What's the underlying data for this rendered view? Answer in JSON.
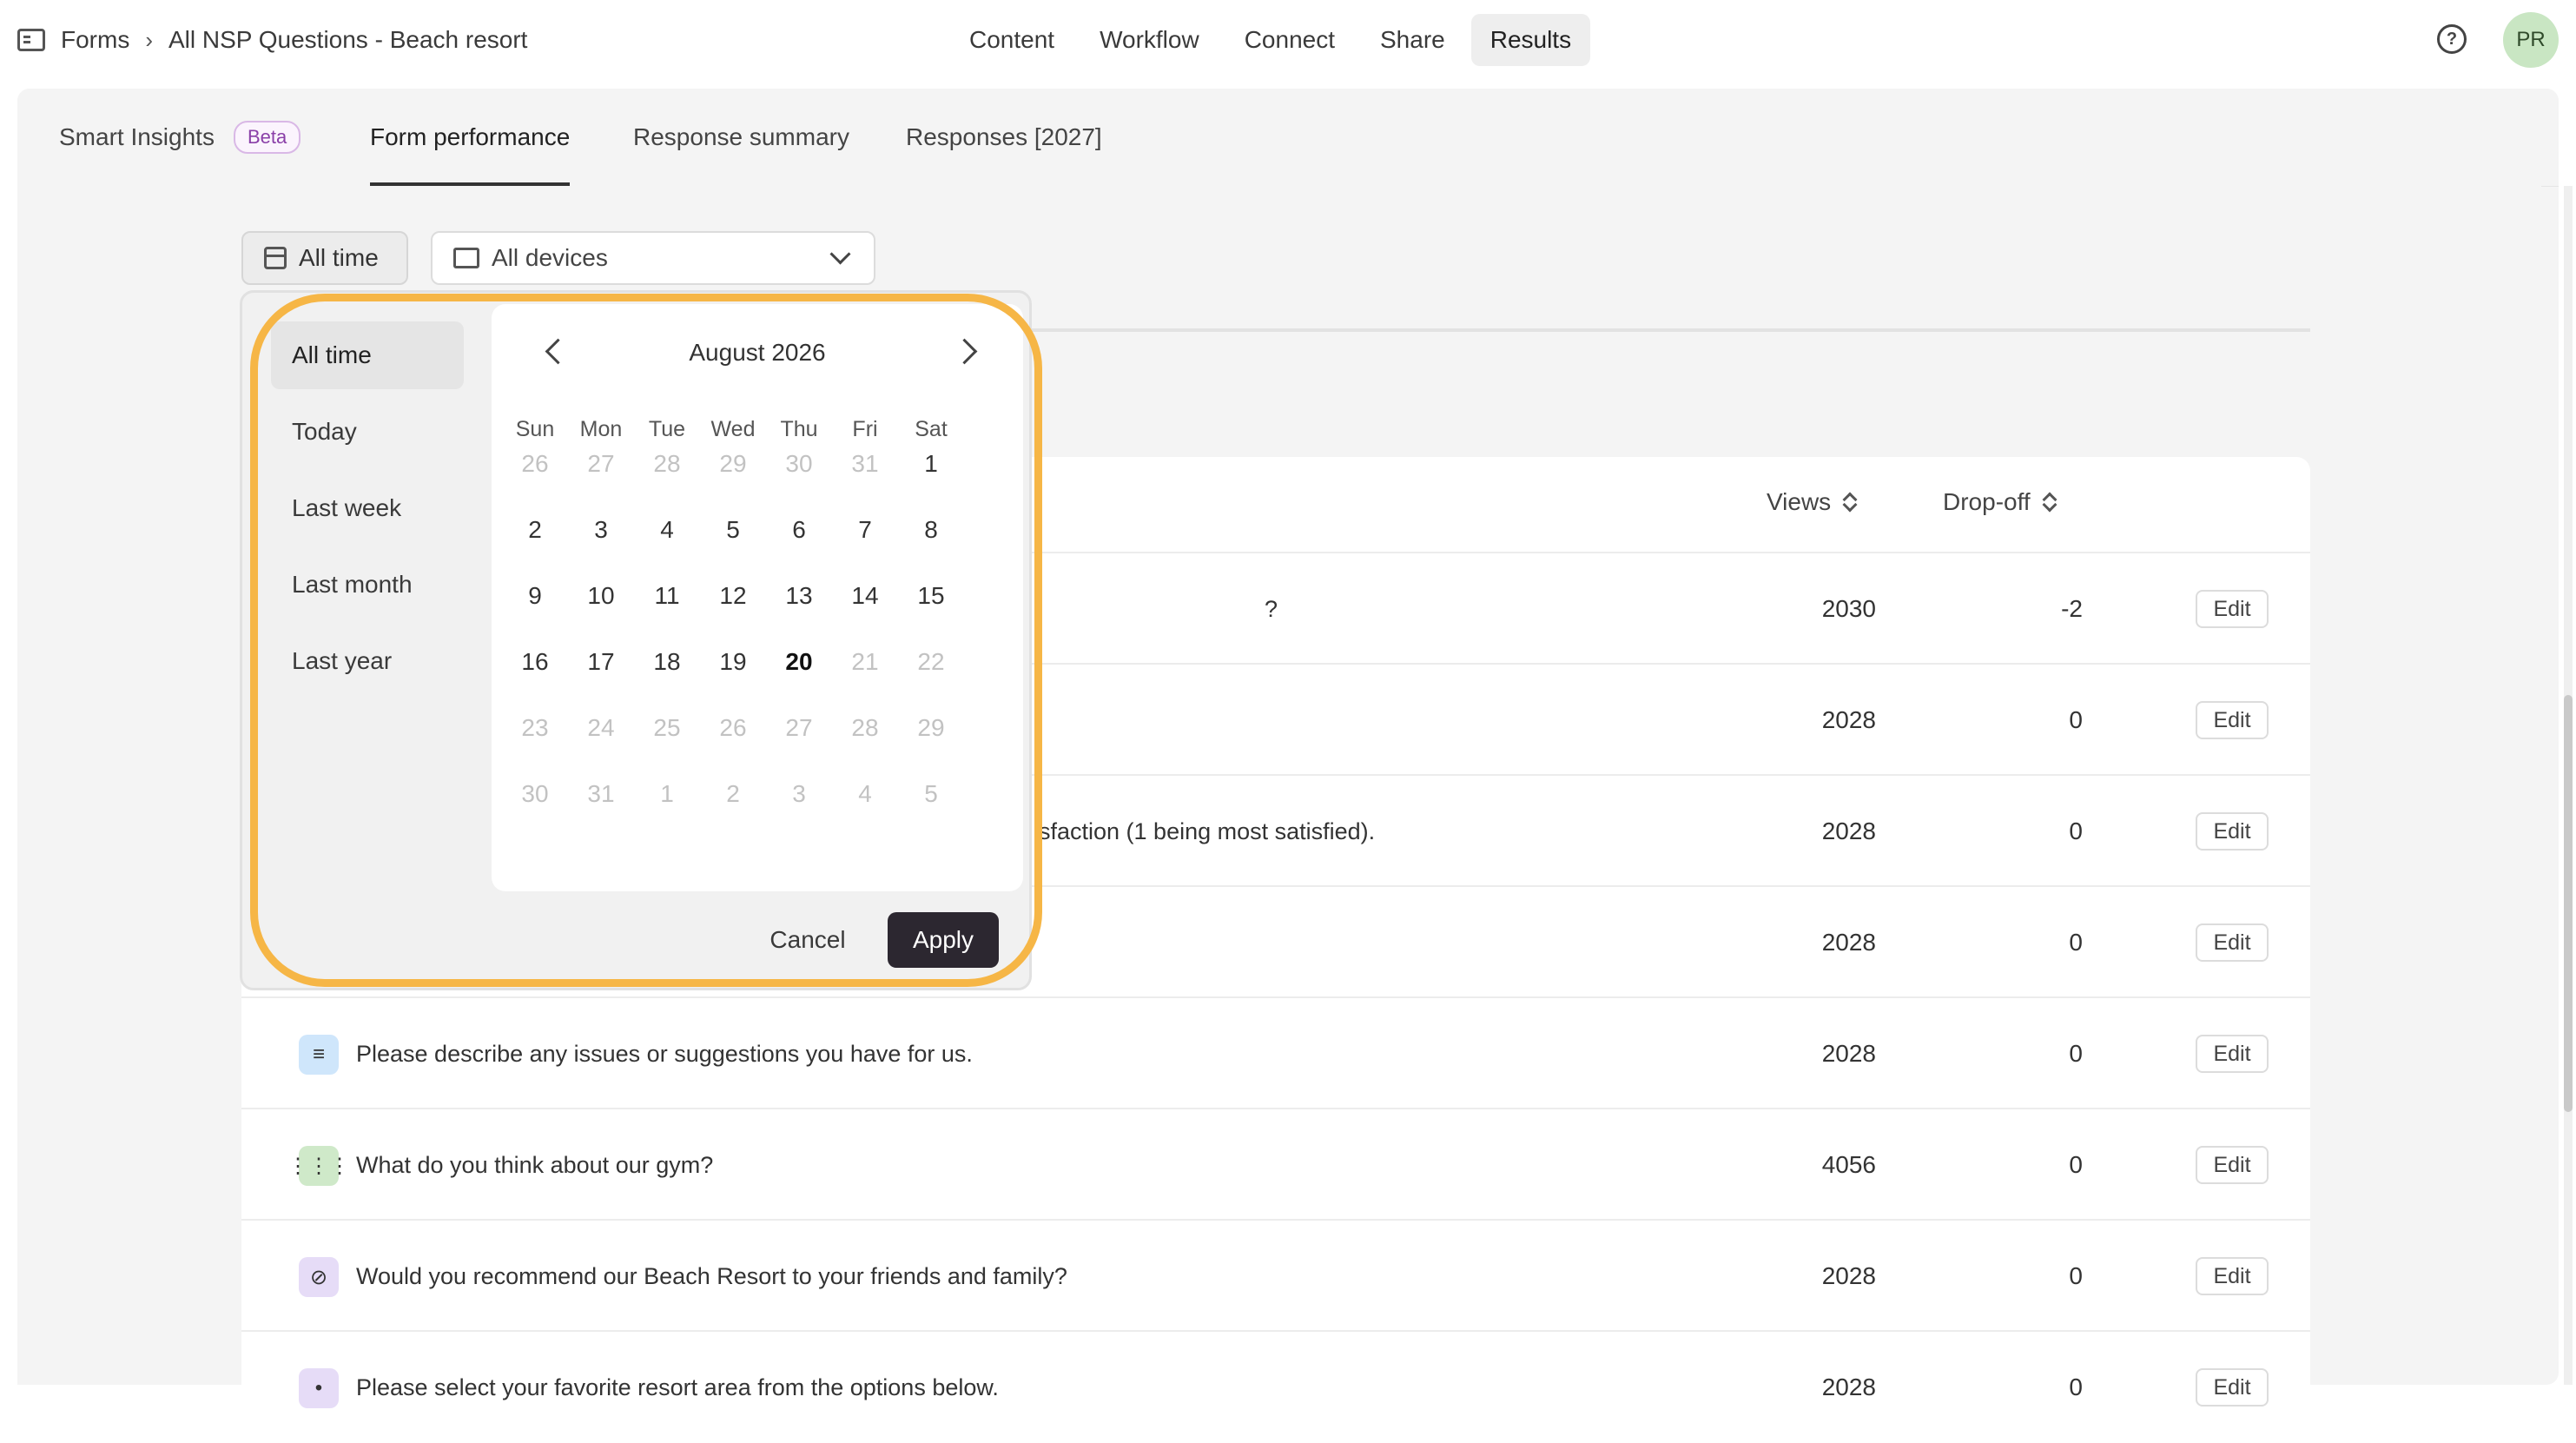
{
  "breadcrumb": {
    "root": "Forms",
    "separator": "›",
    "current": "All NSP Questions - Beach resort"
  },
  "nav": {
    "tabs": [
      "Content",
      "Workflow",
      "Connect",
      "Share",
      "Results"
    ],
    "active": "Results"
  },
  "user": {
    "initials": "PR",
    "help_icon": "question-circle-icon"
  },
  "subtabs": {
    "smart_insights": "Smart Insights",
    "beta": "Beta",
    "form_performance": "Form performance",
    "response_summary": "Response summary",
    "responses": "Responses [2027]"
  },
  "filters": {
    "date": "All time",
    "devices": "All devices"
  },
  "table": {
    "headers": {
      "views": "Views",
      "dropoff": "Drop-off"
    },
    "rows": [
      {
        "text": "?",
        "views": "2030",
        "dropoff": "-2",
        "edit": "Edit"
      },
      {
        "text": "",
        "views": "2028",
        "dropoff": "0",
        "edit": "Edit"
      },
      {
        "text": "sfaction (1 being most satisfied).",
        "views": "2028",
        "dropoff": "0",
        "edit": "Edit"
      },
      {
        "text": "",
        "views": "2028",
        "dropoff": "0",
        "edit": "Edit"
      },
      {
        "text": "Please describe any issues or suggestions you have for us.",
        "views": "2028",
        "dropoff": "0",
        "edit": "Edit",
        "icon": "long-text-icon",
        "icon_color": "#cfe6fb"
      },
      {
        "text": "What do you think about our gym?",
        "views": "4056",
        "dropoff": "0",
        "edit": "Edit",
        "icon": "matrix-icon",
        "icon_color": "#cfe9c9"
      },
      {
        "text": "Would you recommend our Beach Resort to your friends and family?",
        "views": "2028",
        "dropoff": "0",
        "edit": "Edit",
        "icon": "ban-icon",
        "icon_color": "#e6dcf7"
      },
      {
        "text": "Please select your favorite resort area from the options below.",
        "views": "2028",
        "dropoff": "0",
        "edit": "Edit",
        "icon": "multi-choice-icon",
        "icon_color": "#e6dcf7"
      }
    ]
  },
  "datepicker": {
    "presets": [
      "All time",
      "Today",
      "Last week",
      "Last month",
      "Last year"
    ],
    "active_preset": "All time",
    "month": "August 2026",
    "weekdays": [
      "Sun",
      "Mon",
      "Tue",
      "Wed",
      "Thu",
      "Fri",
      "Sat"
    ],
    "weeks": [
      [
        "26",
        "27",
        "28",
        "29",
        "30",
        "31",
        "1"
      ],
      [
        "2",
        "3",
        "4",
        "5",
        "6",
        "7",
        "8"
      ],
      [
        "9",
        "10",
        "11",
        "12",
        "13",
        "14",
        "15"
      ],
      [
        "16",
        "17",
        "18",
        "19",
        "20",
        "21",
        "22"
      ],
      [
        "23",
        "24",
        "25",
        "26",
        "27",
        "28",
        "29"
      ],
      [
        "30",
        "31",
        "1",
        "2",
        "3",
        "4",
        "5"
      ]
    ],
    "today": "20",
    "cancel": "Cancel",
    "apply": "Apply"
  },
  "colors": {
    "highlight": "#f6b646",
    "apply_bg": "#2c2730",
    "avatar_bg": "#c9e6c3"
  }
}
